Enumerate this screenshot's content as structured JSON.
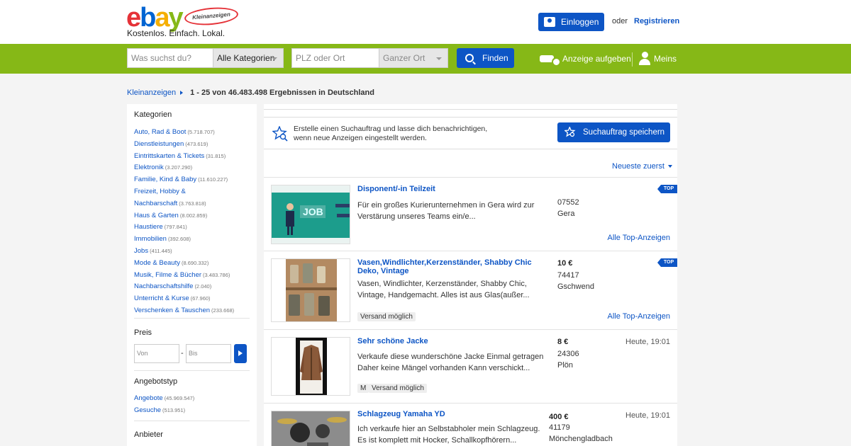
{
  "header": {
    "logo_text": "ebay",
    "seal_text": "Kleinanzeigen",
    "tagline": "Kostenlos. Einfach. Lokal.",
    "login_label": "Einloggen",
    "or_label": "oder",
    "register_label": "Registrieren"
  },
  "search": {
    "query_placeholder": "Was suchst du?",
    "category_value": "Alle Kategorien",
    "location_placeholder": "PLZ oder Ort",
    "radius_value": "Ganzer Ort",
    "find_label": "Finden",
    "post_ad_label": "Anzeige aufgeben",
    "account_label": "Meins"
  },
  "breadcrumb": {
    "home": "Kleinanzeigen",
    "results": "1 - 25 von 46.483.498 Ergebnissen in Deutschland"
  },
  "sidebar": {
    "categories_heading": "Kategorien",
    "categories": [
      {
        "label": "Auto, Rad & Boot",
        "count": "(5.718.707)"
      },
      {
        "label": "Dienstleistungen",
        "count": "(473.619)"
      },
      {
        "label": "Eintrittskarten & Tickets",
        "count": "(31.815)"
      },
      {
        "label": "Elektronik",
        "count": "(3.207.290)"
      },
      {
        "label": "Familie, Kind & Baby",
        "count": "(11.610.227)"
      },
      {
        "label": "Freizeit, Hobby &",
        "count": ""
      },
      {
        "label": "Nachbarschaft",
        "count": "(3.763.818)"
      },
      {
        "label": "Haus & Garten",
        "count": "(8.002.859)"
      },
      {
        "label": "Haustiere",
        "count": "(797.841)"
      },
      {
        "label": "Immobilien",
        "count": "(392.608)"
      },
      {
        "label": "Jobs",
        "count": "(411.445)"
      },
      {
        "label": "Mode & Beauty",
        "count": "(8.690.332)"
      },
      {
        "label": "Musik, Filme & Bücher",
        "count": "(3.483.786)"
      },
      {
        "label": "Nachbarschaftshilfe",
        "count": "(2.040)"
      },
      {
        "label": "Unterricht & Kurse",
        "count": "(67.960)"
      },
      {
        "label": "Verschenken & Tauschen",
        "count": "(233.668)"
      }
    ],
    "price_heading": "Preis",
    "price_from_placeholder": "Von",
    "price_dash": "-",
    "price_to_placeholder": "Bis",
    "offer_type_heading": "Angebotstyp",
    "offer_types": [
      {
        "label": "Angebote",
        "count": "(45.969.547)"
      },
      {
        "label": "Gesuche",
        "count": "(513.951)"
      }
    ],
    "provider_heading": "Anbieter"
  },
  "main": {
    "alert_text_1": "Erstelle einen Suchauftrag und lasse dich benachrichtigen,",
    "alert_text_2": "wenn neue Anzeigen eingestellt werden.",
    "save_search_label": "Suchauftrag speichern",
    "sort_label": "Neueste zuerst",
    "top_badge": "TOP",
    "all_top_label": "Alle Top-Anzeigen",
    "items": [
      {
        "title": "Disponent/-in Teilzeit",
        "desc": "Für ein großes Kurierunternehmen in Gera wird zur Verstärung unseres Teams ein/e...",
        "price": "",
        "zip": "07552",
        "city": "Gera",
        "date": "",
        "tags": []
      },
      {
        "title": "Vasen,Windlichter,Kerzenständer, Shabby Chic Deko, Vintage",
        "desc": "Vasen, Windlichter, Kerzenständer, Shabby Chic, Vintage, Handgemacht. Alles ist aus Glas(außer...",
        "price": "10 €",
        "zip": "74417",
        "city": "Gschwend",
        "date": "",
        "tags": [
          "Versand möglich"
        ]
      },
      {
        "title": "Sehr schöne Jacke",
        "desc": "Verkaufe diese wunderschöne Jacke Einmal getragen Daher keine Mängel vorhanden Kann verschickt...",
        "price": "8 €",
        "zip": "24306",
        "city": "Plön",
        "date": "Heute, 19:01",
        "tags": [
          "M",
          "Versand möglich"
        ]
      },
      {
        "title": "Schlagzeug Yamaha YD",
        "desc": "Ich verkaufe hier an Selbstabholer mein Schlagzeug. Es ist komplett mit Hocker, Schallkopfhörern...",
        "price": "400 €",
        "zip": "41179",
        "city": "Mönchengladbach",
        "date": "Heute, 19:01",
        "tags": []
      }
    ]
  },
  "colors": {
    "brand_green": "#86b817",
    "link_blue": "#0d55c5",
    "background": "#f4f4f4"
  }
}
